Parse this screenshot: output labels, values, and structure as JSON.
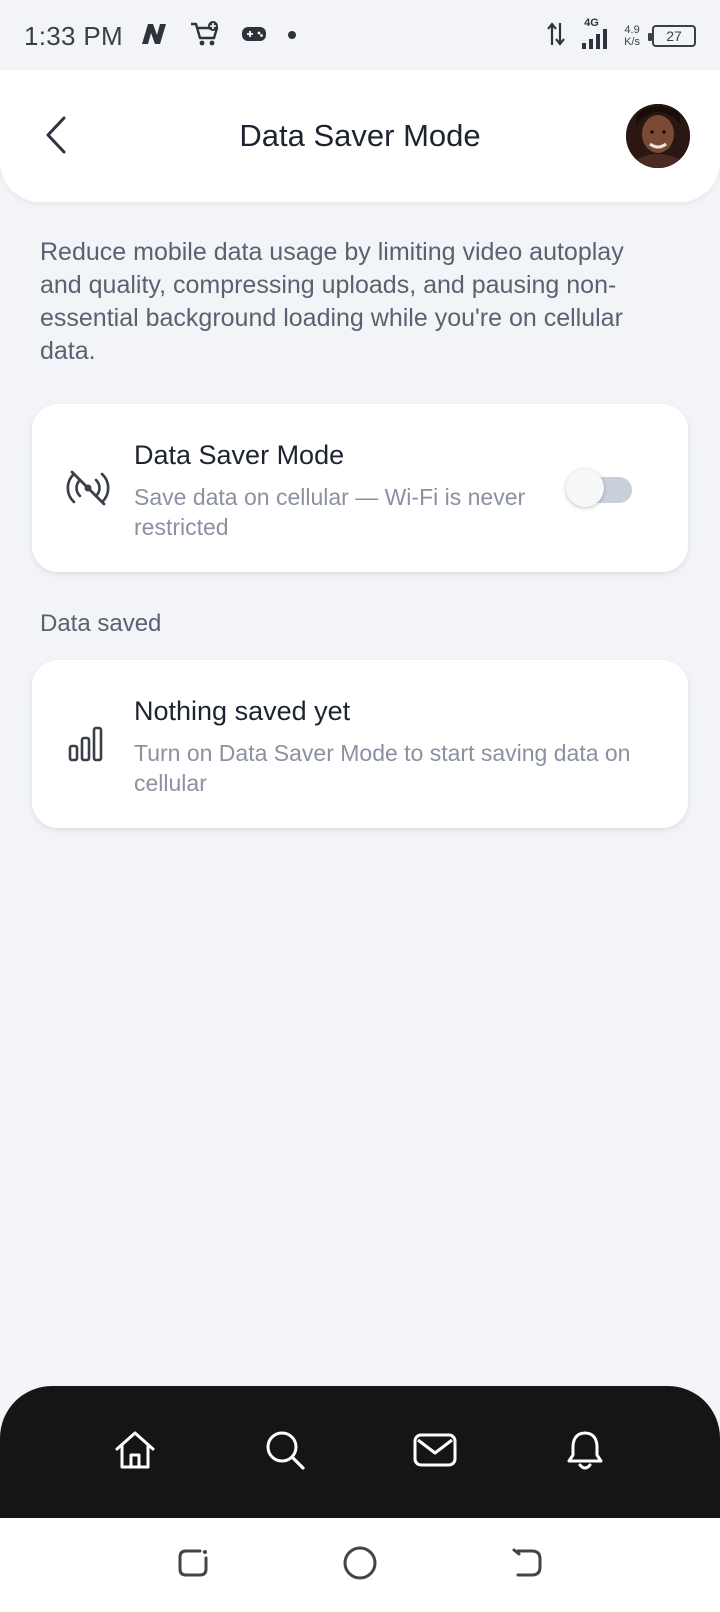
{
  "status_bar": {
    "time": "1:33 PM",
    "network": "4G",
    "speed_value": "4.9",
    "speed_unit": "K/s",
    "battery": "27"
  },
  "header": {
    "title": "Data Saver Mode",
    "back_icon": "chevron-left-icon",
    "avatar": "user-avatar"
  },
  "description": "Reduce mobile data usage by limiting video autoplay and quality, compressing uploads, and pausing non-essential background loading while you're on cellular data.",
  "setting_card": {
    "icon": "wireless-off-icon",
    "title": "Data Saver Mode",
    "subtitle": "Save data on cellular — Wi-Fi is never restricted",
    "toggle_on": false
  },
  "data_saved_section": {
    "label": "Data saved",
    "icon": "bar-chart-icon",
    "title": "Nothing saved yet",
    "subtitle": "Turn on Data Saver Mode to start saving data on cellular"
  },
  "bottom_nav": {
    "items": [
      "home-icon",
      "search-icon",
      "mail-icon",
      "bell-icon"
    ]
  },
  "system_nav": {
    "items": [
      "recents-button",
      "home-button",
      "back-button"
    ]
  },
  "colors": {
    "background": "#f2f4f8",
    "card": "#ffffff",
    "nav_bar": "#151515",
    "toggle_track": "#c9d0dc"
  }
}
